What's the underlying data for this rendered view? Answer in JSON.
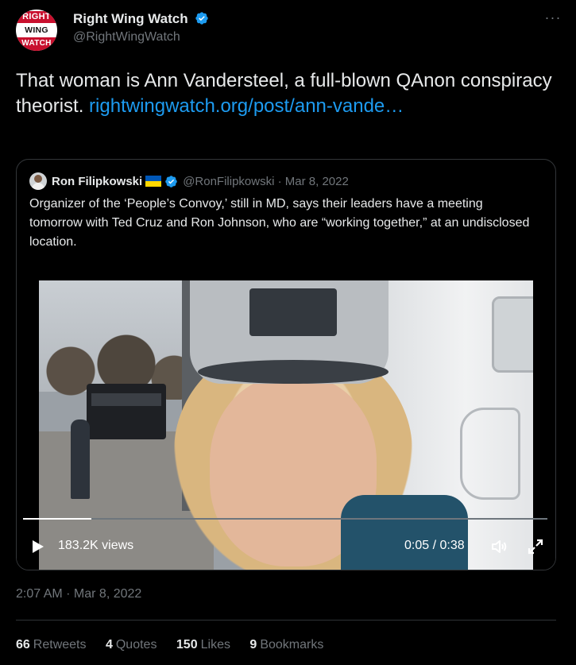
{
  "author": {
    "logo_lines": [
      "RIGHT",
      "WING",
      "WATCH"
    ],
    "display_name": "Right Wing Watch",
    "handle": "@RightWingWatch",
    "verified": true,
    "more_label": "···"
  },
  "tweet": {
    "text": "That woman is Ann Vandersteel, a full-blown QAnon conspiracy theorist. ",
    "link_text": "rightwingwatch.org/post/ann-vande…",
    "timestamp": "2:07 AM · Mar 8, 2022"
  },
  "quoted": {
    "display_name": "Ron Filipkowski",
    "flag": "ukraine-flag-icon",
    "verified": true,
    "meta": "@RonFilipkowski · Mar 8, 2022",
    "text": "Organizer of the ‘People’s Convoy,’ still in MD, says their leaders have a meeting tomorrow with Ted Cruz and Ron Johnson, who are “working together,” at an undisclosed location.",
    "video": {
      "views": "183.2K views",
      "time": "0:05 / 0:38",
      "progress": 0.13
    }
  },
  "stats": [
    {
      "count": "66",
      "label": "Retweets"
    },
    {
      "count": "4",
      "label": "Quotes"
    },
    {
      "count": "150",
      "label": "Likes"
    },
    {
      "count": "9",
      "label": "Bookmarks"
    }
  ],
  "colors": {
    "link": "#1d9bf0",
    "verified": "#1d9bf0",
    "muted": "#71767b",
    "brand_red": "#c8102e"
  }
}
